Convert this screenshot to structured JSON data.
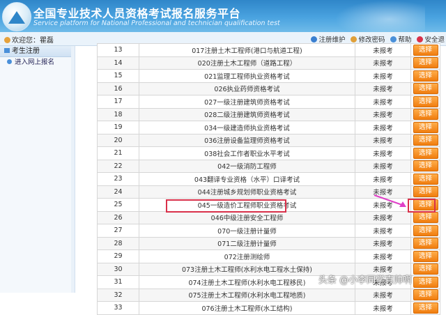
{
  "header": {
    "title_cn": "全国专业技术人员资格考试报名服务平台",
    "title_en": "Service platform for National Professional and technician qualification test"
  },
  "topbar": {
    "welcome": "欢迎您：瞿磊",
    "links": [
      "注册维护",
      "修改密码",
      "帮助",
      "安全退"
    ]
  },
  "sidebar": {
    "header": "考生注册",
    "items": [
      "进入网上报名"
    ]
  },
  "table": {
    "button_label": "选择",
    "rows": [
      {
        "no": "13",
        "name": "017注册土木工程师(港口与航道工程)",
        "status": "未报考"
      },
      {
        "no": "14",
        "name": "020注册土木工程师（道路工程）",
        "status": "未报考"
      },
      {
        "no": "15",
        "name": "021监理工程师执业资格考试",
        "status": "未报考"
      },
      {
        "no": "16",
        "name": "026执业药师资格考试",
        "status": "未报考"
      },
      {
        "no": "17",
        "name": "027一级注册建筑师资格考试",
        "status": "未报考"
      },
      {
        "no": "18",
        "name": "028二级注册建筑师资格考试",
        "status": "未报考"
      },
      {
        "no": "19",
        "name": "034一级建造师执业资格考试",
        "status": "未报考"
      },
      {
        "no": "20",
        "name": "036注册设备监理师资格考试",
        "status": "未报考"
      },
      {
        "no": "21",
        "name": "038社会工作者职业水平考试",
        "status": "未报考"
      },
      {
        "no": "22",
        "name": "042一级消防工程师",
        "status": "未报考"
      },
      {
        "no": "23",
        "name": "043翻译专业资格（水平）口译考试",
        "status": "未报考"
      },
      {
        "no": "24",
        "name": "044注册城乡规划师职业资格考试",
        "status": "未报考"
      },
      {
        "no": "25",
        "name": "045一级造价工程师职业资格考试",
        "status": "未报考"
      },
      {
        "no": "26",
        "name": "046中级注册安全工程师",
        "status": "未报考"
      },
      {
        "no": "27",
        "name": "070一级注册计量师",
        "status": "未报考"
      },
      {
        "no": "28",
        "name": "071二级注册计量师",
        "status": "未报考"
      },
      {
        "no": "29",
        "name": "072注册测绘师",
        "status": "未报考"
      },
      {
        "no": "30",
        "name": "073注册土木工程师(水利水电工程水土保持)",
        "status": "未报考"
      },
      {
        "no": "31",
        "name": "074注册土木工程师(水利水电工程移民)",
        "status": "未报考"
      },
      {
        "no": "32",
        "name": "075注册土木工程师(水利水电工程地质)",
        "status": "未报考"
      },
      {
        "no": "33",
        "name": "076注册土木工程师(水工结构)",
        "status": "未报考"
      }
    ]
  },
  "watermark": "头条 @小李同学真帅啊",
  "colors": {
    "header_blue": "#2f86c9",
    "button_orange": "#f07d0f",
    "highlight_red": "#d9304a",
    "arrow_magenta": "#e040c8"
  }
}
